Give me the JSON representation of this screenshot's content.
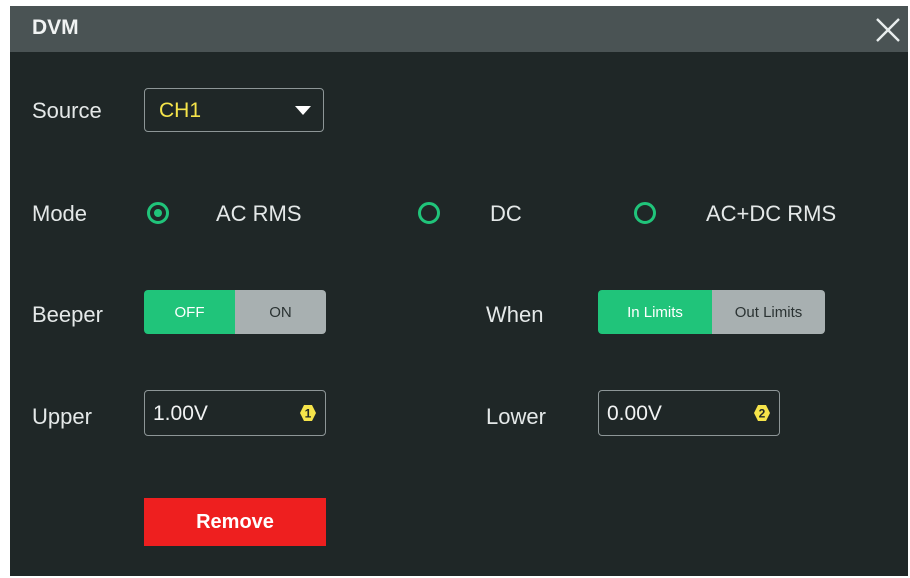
{
  "dialog": {
    "title": "DVM",
    "close_icon": "close-icon"
  },
  "source": {
    "label": "Source",
    "value": "CH1",
    "icon": "chevron-down-icon"
  },
  "mode": {
    "label": "Mode",
    "options": [
      "AC RMS",
      "DC",
      "AC+DC RMS"
    ],
    "selected": "AC RMS"
  },
  "beeper": {
    "label": "Beeper",
    "options": [
      "OFF",
      "ON"
    ],
    "selected": "OFF"
  },
  "when": {
    "label": "When",
    "options": [
      "In Limits",
      "Out Limits"
    ],
    "selected": "In Limits"
  },
  "upper": {
    "label": "Upper",
    "value": "1.00V",
    "knob_badge": "1"
  },
  "lower": {
    "label": "Lower",
    "value": "0.00V",
    "knob_badge": "2"
  },
  "actions": {
    "remove_label": "Remove"
  },
  "colors": {
    "accent": "#20c47a",
    "danger": "#ee1f1f",
    "source_value": "#f5e44a",
    "badge": "#f5e44a"
  }
}
